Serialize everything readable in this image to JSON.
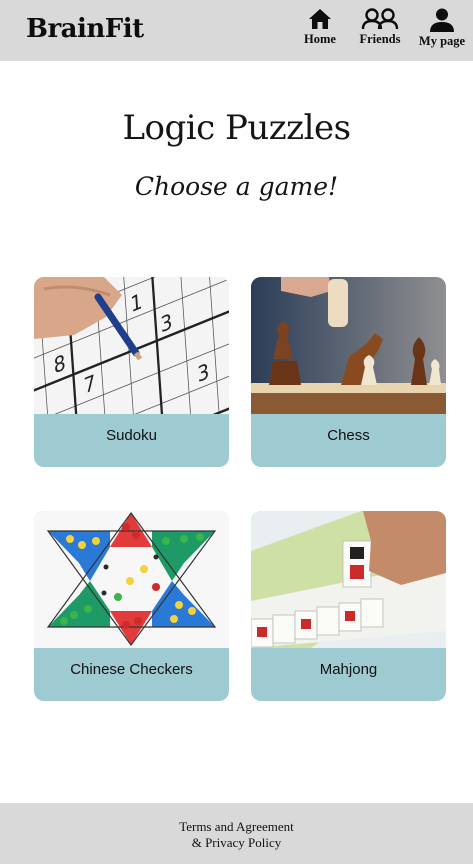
{
  "header": {
    "brand": "BrainFit",
    "nav": {
      "home": "Home",
      "friends": "Friends",
      "my_page": "My page"
    }
  },
  "main": {
    "title": "Logic Puzzles",
    "subtitle": "Choose a game!",
    "games": [
      {
        "label": "Sudoku"
      },
      {
        "label": "Chess"
      },
      {
        "label": "Chinese Checkers"
      },
      {
        "label": "Mahjong"
      }
    ]
  },
  "footer": {
    "line1": "Terms and Agreement",
    "line2": "& Privacy Policy"
  },
  "colors": {
    "bar_bg": "#d9d9d9",
    "card_label_bg": "#9ecad1"
  }
}
